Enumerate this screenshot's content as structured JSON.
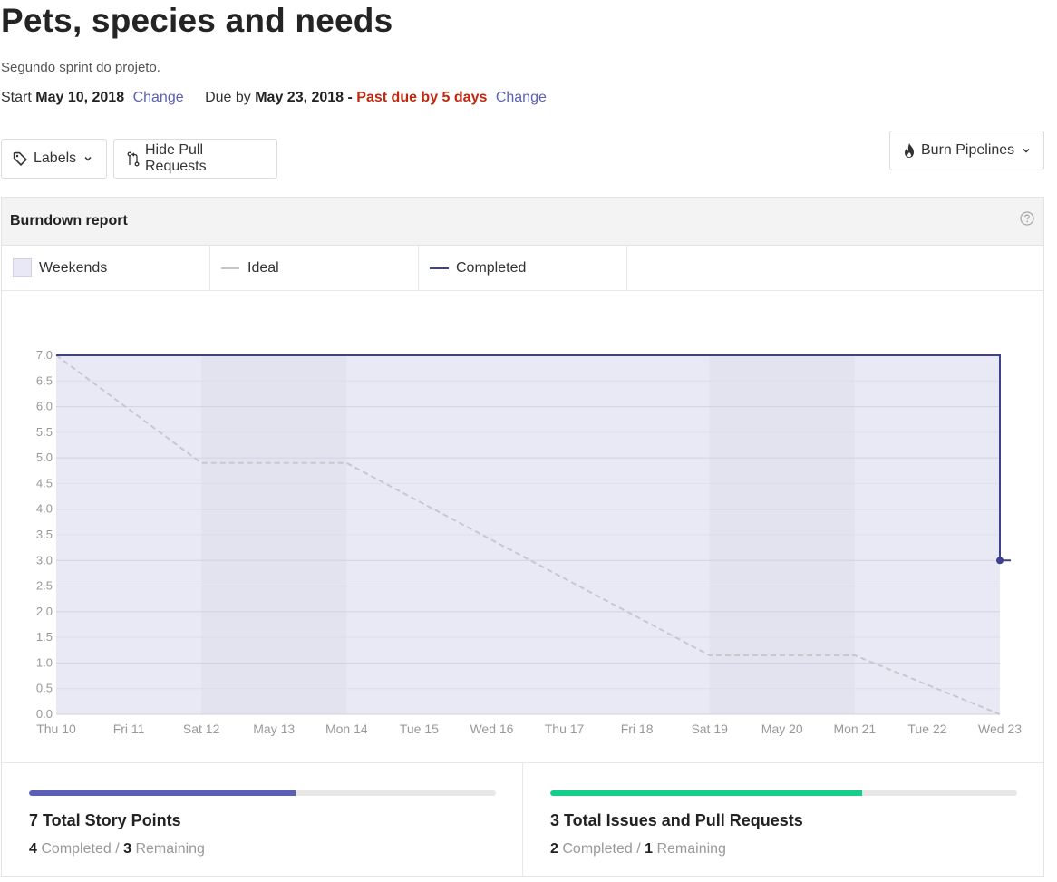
{
  "header": {
    "title": "Pets, species and needs",
    "description": "Segundo sprint do projeto.",
    "start_label": "Start",
    "start_date": "May 10, 2018",
    "change_label": "Change",
    "due_label": "Due by",
    "due_date": "May 23, 2018 -",
    "past_due": "Past due by 5 days"
  },
  "toolbar": {
    "labels_button": "Labels",
    "hide_pr_button": "Hide Pull Requests",
    "burn_pipelines_button": "Burn Pipelines"
  },
  "report": {
    "title": "Burndown report",
    "legend": {
      "weekends": "Weekends",
      "ideal": "Ideal",
      "completed": "Completed"
    }
  },
  "colors": {
    "accent": "#5b5fb8",
    "past_due": "#c0280f",
    "completed_line": "#3d4190",
    "ideal_line": "#c8c8cc",
    "chart_fill": "#e9e9f6",
    "weekend_band": "#e3e3ef",
    "story_points_bar": "#5b5fb8",
    "issues_bar": "#12cf8a"
  },
  "icons": {
    "labels": "tag-icon",
    "hide_pr": "git-pull-request-icon",
    "burn": "flame-icon",
    "help": "question-circle-icon",
    "dropdown": "chevron-down-icon"
  },
  "chart_data": {
    "type": "line",
    "x": [
      "Thu 10",
      "Fri 11",
      "Sat 12",
      "May 13",
      "Mon 14",
      "Tue 15",
      "Wed 16",
      "Thu 17",
      "Fri 18",
      "Sat 19",
      "May 20",
      "Mon 21",
      "Tue 22",
      "Wed 23"
    ],
    "ylim": [
      0,
      7
    ],
    "yticks": [
      "0.0",
      "0.5",
      "1.0",
      "1.5",
      "2.0",
      "2.5",
      "3.0",
      "3.5",
      "4.0",
      "4.5",
      "5.0",
      "5.5",
      "6.0",
      "6.5",
      "7.0"
    ],
    "weekend_bands": [
      [
        2,
        4
      ],
      [
        9,
        11
      ]
    ],
    "series": [
      {
        "name": "Ideal",
        "style": "dashed",
        "points": [
          [
            0,
            7
          ],
          [
            2,
            4.9
          ],
          [
            4,
            4.9
          ],
          [
            9,
            1.15
          ],
          [
            11,
            1.15
          ],
          [
            13,
            0
          ]
        ]
      },
      {
        "name": "Completed",
        "style": "solid",
        "points": [
          [
            0,
            7
          ],
          [
            13,
            7
          ],
          [
            13,
            3
          ],
          [
            13.15,
            3
          ]
        ]
      }
    ],
    "grid": true,
    "legend": "top"
  },
  "stats": {
    "story_points": {
      "title": "7 Total Story Points",
      "completed": "4",
      "remaining": "3",
      "completed_label": "Completed",
      "remaining_label": "Remaining",
      "separator": "/",
      "progress": 0.57
    },
    "issues": {
      "title": "3 Total Issues and Pull Requests",
      "completed": "2",
      "remaining": "1",
      "completed_label": "Completed",
      "remaining_label": "Remaining",
      "separator": "/",
      "progress": 0.667
    }
  }
}
